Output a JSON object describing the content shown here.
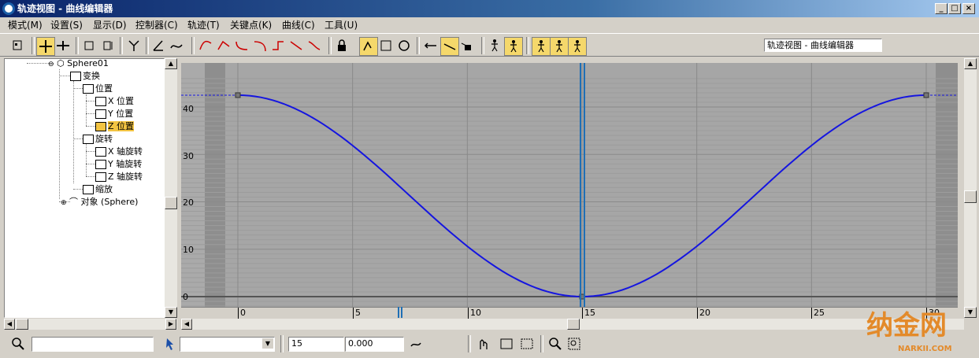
{
  "window": {
    "title": "轨迹视图 - 曲线编辑器"
  },
  "menu": [
    {
      "label": "模式(M)"
    },
    {
      "label": "设置(S)"
    },
    {
      "label": "显示(D)"
    },
    {
      "label": "控制器(C)"
    },
    {
      "label": "轨迹(T)"
    },
    {
      "label": "关键点(K)"
    },
    {
      "label": "曲线(C)"
    },
    {
      "label": "工具(U)"
    }
  ],
  "toolbar": {
    "view_name": "轨迹视图 - 曲线编辑器"
  },
  "tree": {
    "items": [
      {
        "label": "Sphere01"
      },
      {
        "label": "变换"
      },
      {
        "label": "位置"
      },
      {
        "label": "X 位置"
      },
      {
        "label": "Y 位置"
      },
      {
        "label": "Z 位置"
      },
      {
        "label": "旋转"
      },
      {
        "label": "X 轴旋转"
      },
      {
        "label": "Y 轴旋转"
      },
      {
        "label": "Z 轴旋转"
      },
      {
        "label": "缩放"
      },
      {
        "label": "对象 (Sphere)"
      }
    ],
    "selected": "Z 位置"
  },
  "graph": {
    "y_ticks": [
      "40",
      "30",
      "20",
      "10",
      "0"
    ],
    "x_ticks": [
      "0",
      "5",
      "10",
      "15",
      "20",
      "25",
      "30"
    ],
    "current_frame": 15,
    "curve_color": "#1515e0",
    "timeline_color": "#1f6fb5"
  },
  "status": {
    "frame_value": "15",
    "value_field": "0.000"
  },
  "watermark": {
    "main": "纳金网",
    "sub": "NARKII.COM"
  }
}
